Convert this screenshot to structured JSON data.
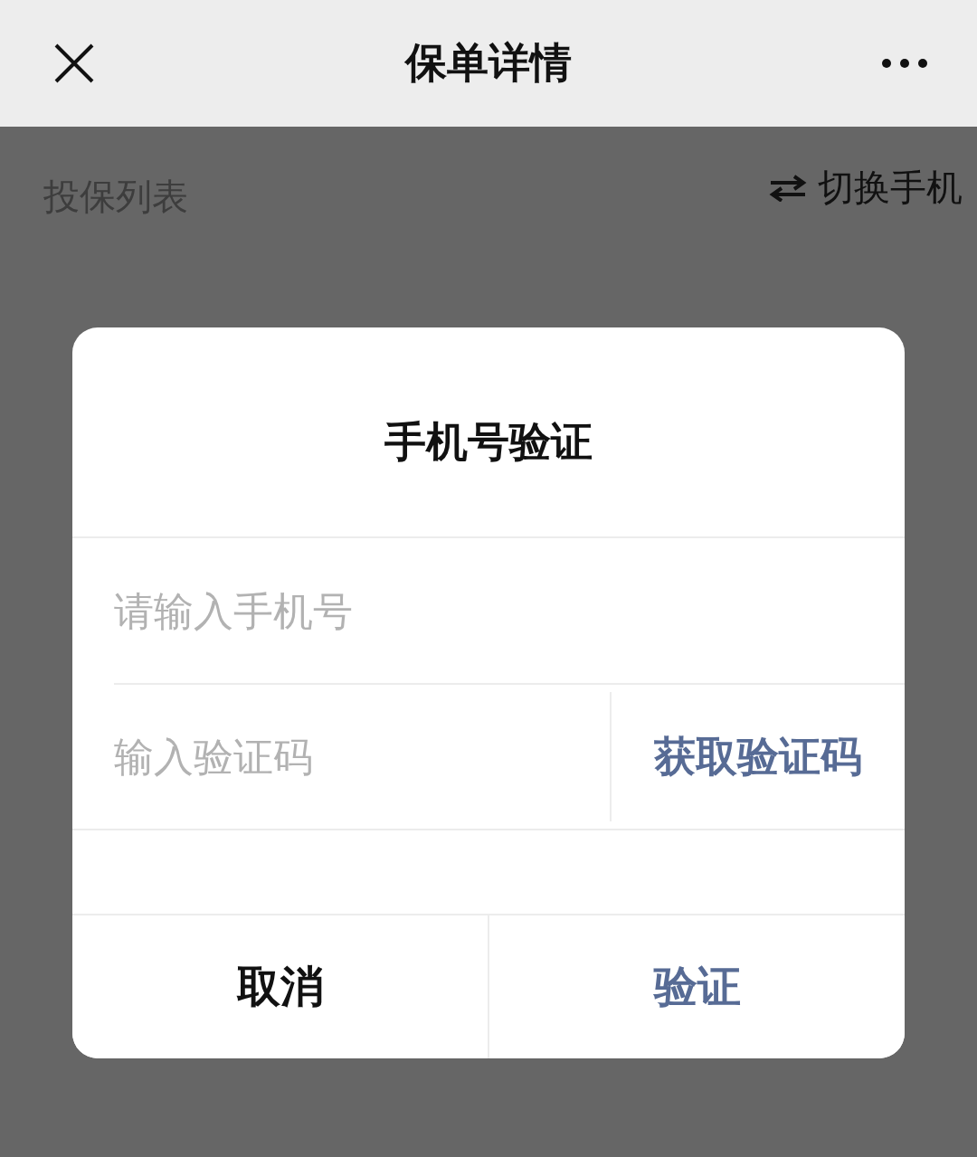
{
  "nav": {
    "title": "保单详情"
  },
  "page": {
    "list_title": "投保列表",
    "switch_phone": "切换手机"
  },
  "dialog": {
    "title": "手机号验证",
    "phone_field": {
      "placeholder": "请输入手机号"
    },
    "code_field": {
      "placeholder": "输入验证码"
    },
    "get_code_button": "获取验证码",
    "buttons": [
      {
        "label": "取消",
        "kind": "cancel"
      },
      {
        "label": "验证",
        "kind": "confirm"
      }
    ]
  }
}
